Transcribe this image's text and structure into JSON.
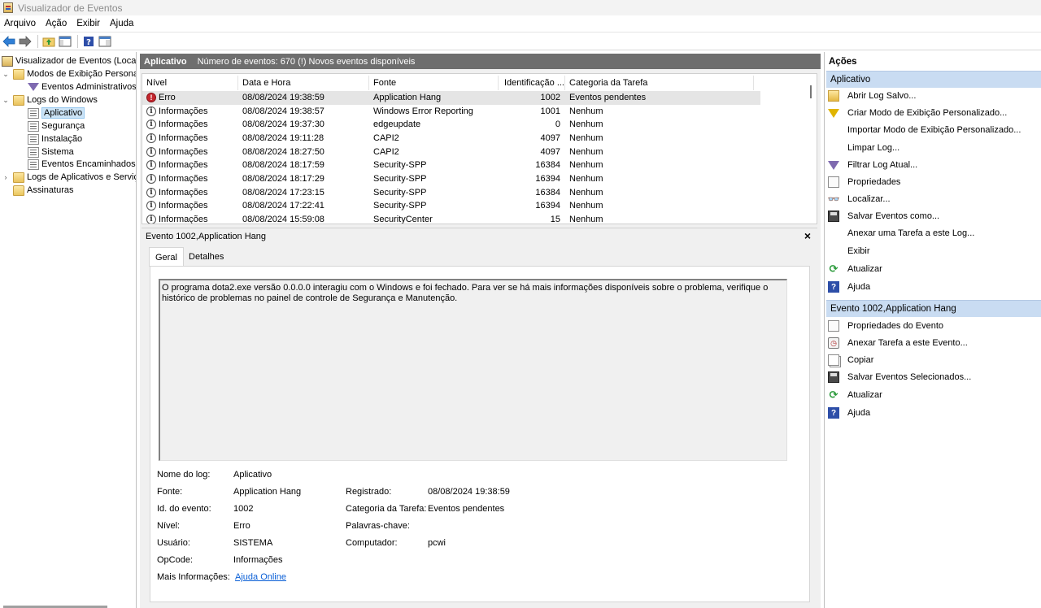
{
  "window": {
    "title": "Visualizador de Eventos"
  },
  "menu": [
    "Arquivo",
    "Ação",
    "Exibir",
    "Ajuda"
  ],
  "tree": {
    "root": "Visualizador de Eventos (Local)",
    "custom_views": "Modos de Exibição Personalizados",
    "admin_events": "Eventos Administrativos",
    "windows_logs": "Logs do Windows",
    "app": "Aplicativo",
    "security": "Segurança",
    "setup": "Instalação",
    "system": "Sistema",
    "forwarded": "Eventos Encaminhados",
    "apps_services": "Logs de Aplicativos e Serviços",
    "subscriptions": "Assinaturas"
  },
  "log_header": {
    "name": "Aplicativo",
    "info": "Número de eventos: 670 (!) Novos eventos disponíveis"
  },
  "columns": {
    "level": "Nível",
    "date": "Data e Hora",
    "source": "Fonte",
    "id": "Identificação ...",
    "category": "Categoria da Tarefa"
  },
  "events": [
    {
      "level": "Erro",
      "date": "08/08/2024 19:38:59",
      "source": "Application Hang",
      "id": "1002",
      "category": "Eventos pendentes"
    },
    {
      "level": "Informações",
      "date": "08/08/2024 19:38:57",
      "source": "Windows Error Reporting",
      "id": "1001",
      "category": "Nenhum"
    },
    {
      "level": "Informações",
      "date": "08/08/2024 19:37:30",
      "source": "edgeupdate",
      "id": "0",
      "category": "Nenhum"
    },
    {
      "level": "Informações",
      "date": "08/08/2024 19:11:28",
      "source": "CAPI2",
      "id": "4097",
      "category": "Nenhum"
    },
    {
      "level": "Informações",
      "date": "08/08/2024 18:27:50",
      "source": "CAPI2",
      "id": "4097",
      "category": "Nenhum"
    },
    {
      "level": "Informações",
      "date": "08/08/2024 18:17:59",
      "source": "Security-SPP",
      "id": "16384",
      "category": "Nenhum"
    },
    {
      "level": "Informações",
      "date": "08/08/2024 18:17:29",
      "source": "Security-SPP",
      "id": "16394",
      "category": "Nenhum"
    },
    {
      "level": "Informações",
      "date": "08/08/2024 17:23:15",
      "source": "Security-SPP",
      "id": "16384",
      "category": "Nenhum"
    },
    {
      "level": "Informações",
      "date": "08/08/2024 17:22:41",
      "source": "Security-SPP",
      "id": "16394",
      "category": "Nenhum"
    },
    {
      "level": "Informações",
      "date": "08/08/2024 15:59:08",
      "source": "SecurityCenter",
      "id": "15",
      "category": "Nenhum"
    }
  ],
  "detail": {
    "title": "Evento 1002,Application Hang",
    "close": "×",
    "tab_general": "Geral",
    "tab_details": "Detalhes",
    "description": "O programa dota2.exe versão 0.0.0.0 interagiu com o Windows e foi fechado. Para ver se há mais informações disponíveis sobre o problema, verifique o histórico de problemas no painel de controle de Segurança e Manutenção.",
    "labels": {
      "log_name": "Nome do log:",
      "source": "Fonte:",
      "event_id": "Id. do evento:",
      "level": "Nível:",
      "user": "Usuário:",
      "opcode": "OpCode:",
      "more_info": "Mais Informações:",
      "logged": "Registrado:",
      "task_category": "Categoria da Tarefa:",
      "keywords": "Palavras-chave:",
      "computer": "Computador:"
    },
    "values": {
      "log_name": "Aplicativo",
      "source": "Application Hang",
      "event_id": "1002",
      "level": "Erro",
      "user": "SISTEMA",
      "opcode": "Informações",
      "more_info": "Ajuda Online",
      "logged": "08/08/2024 19:38:59",
      "task_category": "Eventos pendentes",
      "keywords": "",
      "computer": "pcwi"
    }
  },
  "actions": {
    "title": "Ações",
    "section1": "Aplicativo",
    "items1": [
      {
        "label": "Abrir Log Salvo...",
        "icon": "folder-open-icon"
      },
      {
        "label": "Criar Modo de Exibição Personalizado...",
        "icon": "create-view-icon"
      },
      {
        "label": "Importar Modo de Exibição Personalizado...",
        "icon": ""
      },
      {
        "label": "Limpar Log...",
        "icon": ""
      },
      {
        "label": "Filtrar Log Atual...",
        "icon": "filter-icon"
      },
      {
        "label": "Propriedades",
        "icon": "properties-icon"
      },
      {
        "label": "Localizar...",
        "icon": "binoculars-icon"
      },
      {
        "label": "Salvar Eventos como...",
        "icon": "save-icon"
      },
      {
        "label": "Anexar uma Tarefa a este Log...",
        "icon": ""
      },
      {
        "label": "Exibir",
        "icon": ""
      },
      {
        "label": "Atualizar",
        "icon": "refresh-icon"
      },
      {
        "label": "Ajuda",
        "icon": "help-icon"
      }
    ],
    "section2": "Evento 1002,Application Hang",
    "items2": [
      {
        "label": "Propriedades do Evento",
        "icon": "properties-icon"
      },
      {
        "label": "Anexar Tarefa a este Evento...",
        "icon": "task-icon"
      },
      {
        "label": "Copiar",
        "icon": "copy-icon"
      },
      {
        "label": "Salvar Eventos Selecionados...",
        "icon": "save-icon"
      },
      {
        "label": "Atualizar",
        "icon": "refresh-icon"
      },
      {
        "label": "Ajuda",
        "icon": "help-icon"
      }
    ]
  },
  "icons": {
    "help": "?",
    "refresh": "⟳",
    "back": "⬅",
    "forward": "➡"
  }
}
